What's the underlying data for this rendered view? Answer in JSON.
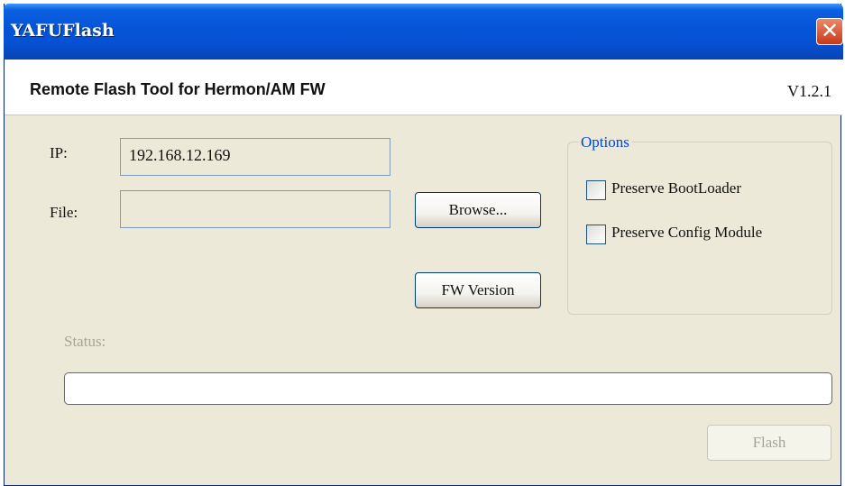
{
  "window": {
    "title": "YAFUFlash",
    "close_glyph": "✕"
  },
  "header": {
    "subtitle": "Remote Flash Tool for Hermon/AM FW",
    "version": "V1.2.1"
  },
  "form": {
    "ip_label": "IP:",
    "ip_value": "192.168.12.169",
    "file_label": "File:",
    "file_value": "",
    "browse_label": "Browse...",
    "fw_version_label": "FW Version"
  },
  "options": {
    "legend": "Options",
    "items": [
      {
        "label": "Preserve BootLoader",
        "checked": false
      },
      {
        "label": "Preserve Config Module",
        "checked": false
      }
    ]
  },
  "status": {
    "label": "Status:",
    "progress": 0
  },
  "actions": {
    "flash_label": "Flash",
    "flash_enabled": false
  }
}
